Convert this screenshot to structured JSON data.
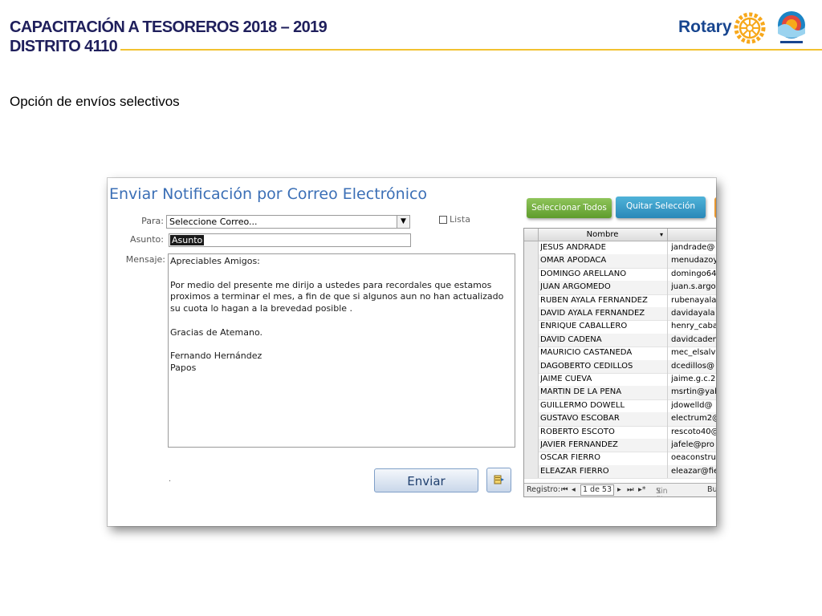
{
  "slide": {
    "title_line1": "CAPACITACIÓN A TESOREROS 2018 – 2019",
    "title_line2": "DISTRITO 4110",
    "brand": "Rotary",
    "subtitle": "Opción de envíos selectivos"
  },
  "colors": {
    "title": "#1f1f5c",
    "rule": "#f2c230",
    "rotary_blue": "#17458f",
    "rotary_gold": "#f7a81b",
    "form_title": "#3b6fb6",
    "btn_green": "#6aa834",
    "btn_blue": "#3399cc",
    "btn_orange": "#e6962f"
  },
  "form": {
    "title": "Enviar Notificación por Correo Electrónico",
    "para_label": "Para:",
    "para_value": "Seleccione Correo...",
    "lista_label": "Lista",
    "asunto_label": "Asunto:",
    "asunto_value": "Asunto",
    "mensaje_label": "Mensaje:",
    "message": "Apreciables Amigos:\n\nPor medio del presente me dirijo a ustedes para recordales que estamos proximos a terminar el mes, a fin de que si algunos aun no han actualizado su cuota lo hagan a la brevedad posible .\n\nGracias de Atemano.\n\nFernando Hernández\nPapos",
    "dot": ".",
    "send_label": "Enviar",
    "select_all_label": "Seleccionar Todos",
    "clear_selection_label": "Quitar Selección"
  },
  "grid": {
    "header_nombre": "Nombre",
    "rows": [
      {
        "nombre": "JESUS ANDRADE",
        "correo": "jandrade@"
      },
      {
        "nombre": "OMAR APODACA",
        "correo": "menudazoy"
      },
      {
        "nombre": "DOMINGO ARELLANO",
        "correo": "domingo64"
      },
      {
        "nombre": "JUAN ARGOMEDO",
        "correo": "juan.s.argo"
      },
      {
        "nombre": "RUBEN AYALA FERNANDEZ",
        "correo": "rubenayala"
      },
      {
        "nombre": "DAVID AYALA FERNANDEZ",
        "correo": "davidayala"
      },
      {
        "nombre": "ENRIQUE CABALLERO",
        "correo": "henry_caba"
      },
      {
        "nombre": "DAVID CADENA",
        "correo": "davidcaden"
      },
      {
        "nombre": "MAURICIO CASTANEDA",
        "correo": "mec_elsalv"
      },
      {
        "nombre": "DAGOBERTO CEDILLOS",
        "correo": "dcedillos@"
      },
      {
        "nombre": "JAIME CUEVA",
        "correo": "jaime.g.c.2"
      },
      {
        "nombre": "MARTIN DE LA PEÑA",
        "correo": "msrtin@yah"
      },
      {
        "nombre": "GUILLERMO DOWELL",
        "correo": "jdowelld@"
      },
      {
        "nombre": "GUSTAVO ESCOBAR",
        "correo": "electrum2@"
      },
      {
        "nombre": "ROBERTO ESCOTO",
        "correo": "rescoto40@"
      },
      {
        "nombre": "JAVIER FERNANDEZ",
        "correo": "jafele@pro"
      },
      {
        "nombre": "OSCAR FIERRO",
        "correo": "oeaconstru"
      },
      {
        "nombre": "ELEAZAR FIERRO",
        "correo": "eleazar@fie"
      }
    ],
    "nav": {
      "registro_label": "Registro:",
      "record_value": "1 de 53",
      "filter_label": "Sin filtro",
      "search_label": "Bu"
    }
  }
}
